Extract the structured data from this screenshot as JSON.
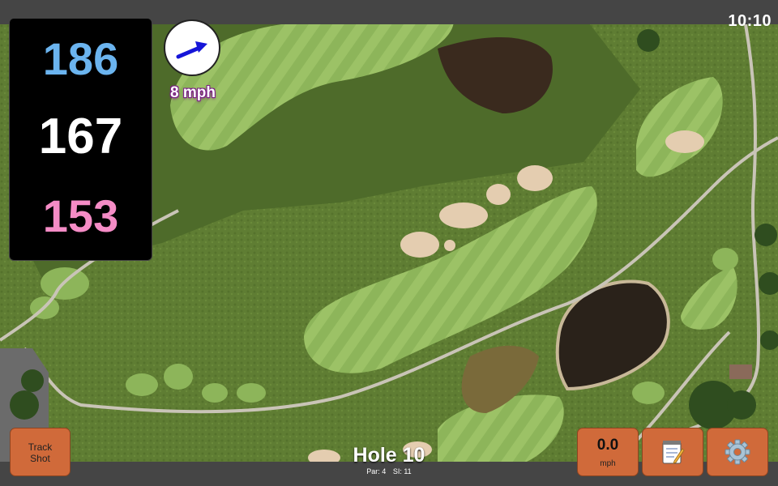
{
  "status_bar": {
    "time": "10:10"
  },
  "distances": {
    "back": {
      "value": "186",
      "color": "#6bb4ef"
    },
    "middle": {
      "value": "167",
      "color": "#ffffff"
    },
    "front": {
      "value": "153",
      "color": "#f58cc6"
    }
  },
  "wind": {
    "icon": "wind-direction-arrow-icon",
    "speed": "8 mph",
    "arrow_color": "#1515d8"
  },
  "hole": {
    "title": "Hole 10",
    "par": "Par: 4",
    "stroke_index": "SI: 11"
  },
  "buttons": {
    "track_shot": {
      "line1": "Track",
      "line2": "Shot"
    },
    "speed": {
      "value": "0.0",
      "unit": "mph"
    },
    "notes": {
      "icon": "notepad-icon"
    },
    "settings": {
      "icon": "gear-icon"
    },
    "accent": "#d06a3a"
  },
  "map": {
    "type": "satellite-golf-course"
  }
}
